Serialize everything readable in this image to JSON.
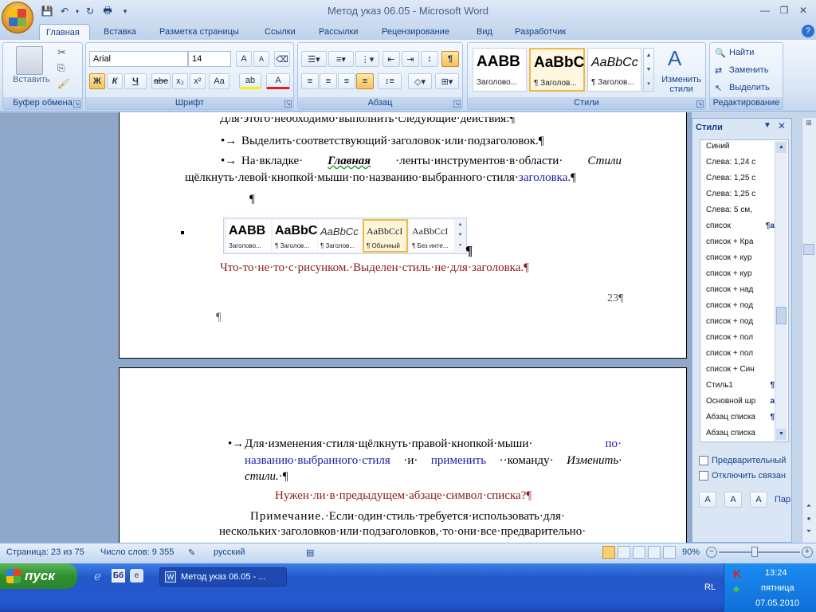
{
  "window": {
    "title": "Метод указ 06.05 - Microsoft Word"
  },
  "tabs": [
    "Главная",
    "Вставка",
    "Разметка страницы",
    "Ссылки",
    "Рассылки",
    "Рецензирование",
    "Вид",
    "Разработчик"
  ],
  "ribbon": {
    "clipboard": {
      "label": "Буфер обмена",
      "paste": "Вставить"
    },
    "font": {
      "label": "Шрифт",
      "name": "Arial",
      "size": "14",
      "bold": "Ж",
      "italic": "К",
      "underline": "Ч",
      "strike": "abe"
    },
    "paragraph": {
      "label": "Абзац"
    },
    "styles": {
      "label": "Стили",
      "items": [
        {
          "sample": "AABB",
          "caption": "Заголово..."
        },
        {
          "sample": "AaBbC",
          "caption": "¶ Заголов..."
        },
        {
          "sample": "AaBbCc",
          "caption": "¶ Заголов..."
        }
      ],
      "change": "Изменить стили"
    },
    "editing": {
      "label": "Редактирование",
      "find": "Найти",
      "replace": "Заменить",
      "select": "Выделить"
    }
  },
  "document": {
    "page1": {
      "line_top": "Для·этого·необходимо·выполнить·следующие·действия:¶",
      "bullet1": "Выделить·соответствующий·заголовок·или·подзаголовок.¶",
      "bullet2_a": "На·вкладке·",
      "bullet2_b": "Главная",
      "bullet2_c": "·ленты·инструментов·в·области·",
      "bullet2_d": "Стили",
      "bullet2_line2_a": "щёлкнуть·левой·кнопкой·мыши·по·названию·выбранного·стиля·",
      "bullet2_line2_b": "заголовка.",
      "pilcrow": "¶",
      "embedded_styles": [
        {
          "sample": "AABB",
          "caption": "Заголово..."
        },
        {
          "sample": "AaBbC",
          "caption": "¶ Заголов..."
        },
        {
          "sample": "AaBbCc",
          "caption": "¶ Заголов..."
        },
        {
          "sample": "AaBbCcI",
          "caption": "¶ Обычный"
        },
        {
          "sample": "AaBbCcI",
          "caption": "¶ Без инте..."
        }
      ],
      "note_red": "Что-то·не·то·с·рисунком.·Выделен·стиль·не·для·заголовка.¶",
      "page_number": "23¶"
    },
    "page2": {
      "bullet_a": "Для·изменения·стиля·щёлкнуть·правой·кнопкой·мыши·",
      "bullet_a_blue": "по·",
      "bullet_b_blue": "названию·выбранного·стиля",
      "bullet_b_mid": "·и·",
      "bullet_b_blue2": "применить",
      "bullet_b_end": "··команду·",
      "bullet_b_italic": "Изменить·",
      "bullet_c_italic": "стили.",
      "bullet_c_end": "·¶",
      "question_red": "Нужен·ли·в·предыдущем·абзаце·символ·списка?¶",
      "note_a": "Примечание.",
      "note_b": "·Если·один·стиль·требуется·использовать·для·",
      "note_line2": "нескольких·заголовков·или·подзаголовков,·то·они·все·предварительно·"
    }
  },
  "styles_pane": {
    "title": "Стили",
    "items": [
      {
        "name": "Синий",
        "mark": ""
      },
      {
        "name": "Слева:  1,24 с",
        "mark": ""
      },
      {
        "name": "Слева:  1,25 с",
        "mark": ""
      },
      {
        "name": "Слева:  1,25 с",
        "mark": ""
      },
      {
        "name": "Слева:  5 см,",
        "mark": ""
      },
      {
        "name": "список",
        "mark": "¶a"
      },
      {
        "name": "список + Кра",
        "mark": ""
      },
      {
        "name": "список + кур",
        "mark": ""
      },
      {
        "name": "список + кур",
        "mark": ""
      },
      {
        "name": "список + над",
        "mark": ""
      },
      {
        "name": "список + под",
        "mark": ""
      },
      {
        "name": "список + под",
        "mark": ""
      },
      {
        "name": "список + пол",
        "mark": ""
      },
      {
        "name": "список + пол",
        "mark": ""
      },
      {
        "name": "список + Син",
        "mark": ""
      },
      {
        "name": "Стиль1",
        "mark": "¶"
      },
      {
        "name": "Основной шр",
        "mark": "a"
      },
      {
        "name": "Абзац списка",
        "mark": "¶"
      },
      {
        "name": "Абзац списка",
        "mark": ""
      }
    ],
    "preview": "Предварительный",
    "disable_linked": "Отключить связан",
    "params": "Пар"
  },
  "status": {
    "page": "Страница: 23 из 75",
    "words": "Число слов: 9 355",
    "language": "русский",
    "zoom": "90%"
  },
  "taskbar": {
    "start": "пуск",
    "task": "Метод указ 06.05 - ...",
    "lang": "RL",
    "time": "13:24",
    "day": "пятница",
    "date": "07.05.2010"
  },
  "colors": {
    "accent": "#15428b",
    "ribbon": "#dbe8f7",
    "taskbar": "#2458d0",
    "start": "#2f8f2f"
  }
}
